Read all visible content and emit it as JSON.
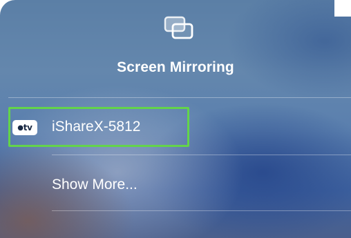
{
  "panel": {
    "title": "Screen Mirroring",
    "icon": "screen-mirroring-icon"
  },
  "devices": [
    {
      "name": "iShareX-5812",
      "badge": "⌘tv",
      "badge_icon": "apple-tv-icon",
      "highlighted": true
    }
  ],
  "show_more_label": "Show More...",
  "colors": {
    "highlight_border": "#63d44a",
    "text": "#ffffff"
  }
}
